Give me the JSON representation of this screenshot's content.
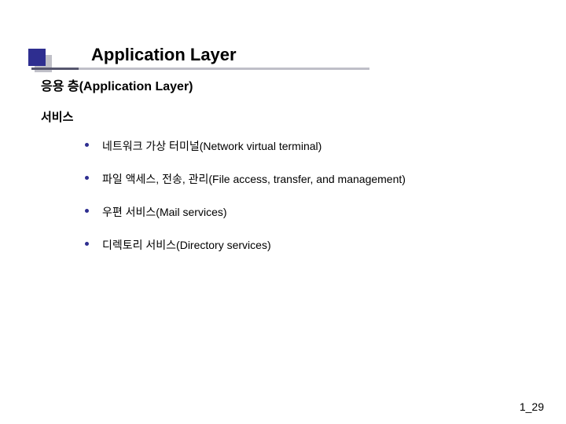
{
  "title": "Application Layer",
  "heading_main": "응용 층(Application Layer)",
  "heading_sub": "서비스",
  "items": [
    "네트워크 가상 터미널(Network virtual terminal)",
    "파일 액세스, 전송, 관리(File access, transfer, and management)",
    "우편 서비스(Mail services)",
    "디렉토리 서비스(Directory services)"
  ],
  "page_number": "1_29"
}
